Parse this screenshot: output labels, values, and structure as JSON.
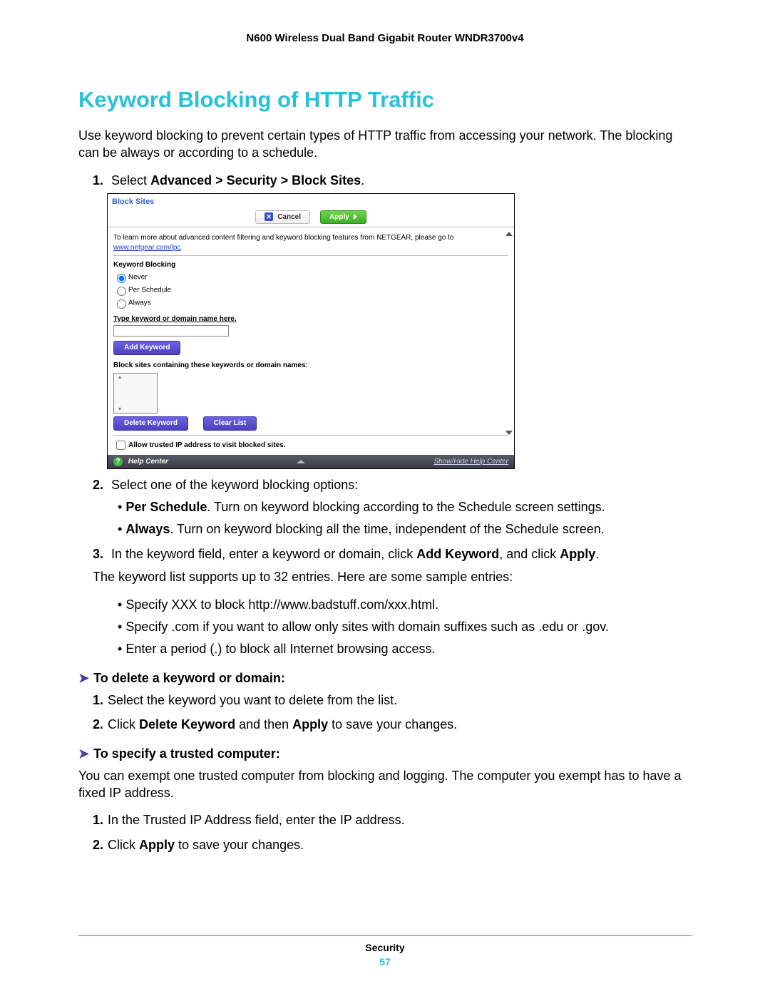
{
  "header": {
    "device": "N600 Wireless Dual Band Gigabit Router WNDR3700v4"
  },
  "title": "Keyword Blocking of HTTP Traffic",
  "intro": "Use keyword blocking to prevent certain types of HTTP traffic from accessing your network. The blocking can be always or according to a schedule.",
  "step1": {
    "num": "1.",
    "prefix": "Select ",
    "bold": "Advanced > Security > Block Sites",
    "suffix": "."
  },
  "shot": {
    "panel_title": "Block Sites",
    "cancel": "Cancel",
    "apply": "Apply",
    "info_prefix": "To learn more about advanced content filtering and keyword blocking features from NETGEAR, please go to ",
    "info_link": "www.netgear.com/lpc",
    "info_suffix": ".",
    "kb_heading": "Keyword Blocking",
    "radio_never": "Never",
    "radio_sched": "Per Schedule",
    "radio_always": "Always",
    "type_kw_label": "Type keyword or domain name here.",
    "add_keyword": "Add Keyword",
    "blocklist_label": "Block sites containing these keywords or domain names:",
    "delete_keyword": "Delete Keyword",
    "clear_list": "Clear List",
    "allow_trusted": "Allow trusted IP address to visit blocked sites.",
    "help_center": "Help Center",
    "show_hide": "Show/Hide Help Center"
  },
  "step2": {
    "num": "2.",
    "text": "Select one of the keyword blocking options:"
  },
  "step2_b1": {
    "bold": "Per Schedule",
    "text": ". Turn on keyword blocking according to the Schedule screen settings."
  },
  "step2_b2": {
    "bold": "Always",
    "text": ". Turn on keyword blocking all the time, independent of the Schedule screen."
  },
  "step3": {
    "num": "3.",
    "pre": "In the keyword field, enter a keyword or domain, click ",
    "b1": "Add Keyword",
    "mid": ", and click ",
    "b2": "Apply",
    "post": ".",
    "supports": "The keyword list supports up to 32 entries. Here are some sample entries:",
    "ex1": "Specify XXX to block http://www.badstuff.com/xxx.html.",
    "ex2": "Specify .com if you want to allow only sites with domain suffixes such as .edu or .gov.",
    "ex3": "Enter a period (.) to block all Internet browsing access."
  },
  "procA": {
    "heading": "To delete a keyword or domain:",
    "s1": {
      "num": "1.",
      "text": "Select the keyword you want to delete from the list."
    },
    "s2": {
      "num": "2.",
      "pre": "Click ",
      "b1": "Delete Keyword",
      "mid": " and then ",
      "b2": "Apply",
      "post": " to save your changes."
    }
  },
  "procB": {
    "heading": "To specify a trusted computer:",
    "intro": "You can exempt one trusted computer from blocking and logging. The computer you exempt has to have a fixed IP address.",
    "s1": {
      "num": "1.",
      "text": "In the Trusted IP Address field, enter the IP address."
    },
    "s2": {
      "num": "2.",
      "pre": "Click ",
      "b1": "Apply",
      "post": " to save your changes."
    }
  },
  "footer": {
    "section": "Security",
    "page": "57"
  }
}
